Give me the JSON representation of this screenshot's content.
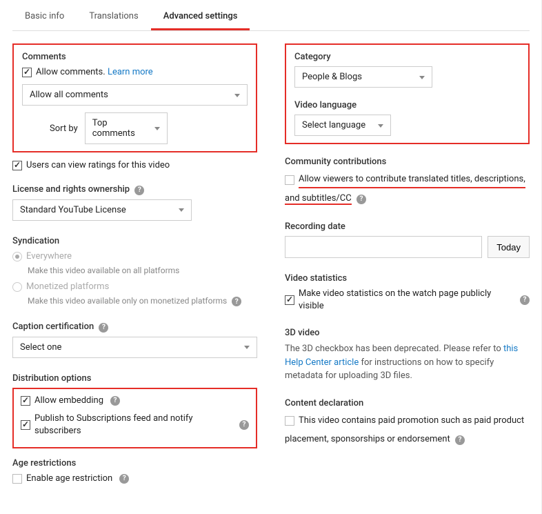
{
  "tabs": {
    "basic": "Basic info",
    "translations": "Translations",
    "advanced": "Advanced settings"
  },
  "left": {
    "comments": {
      "title": "Comments",
      "allow": "Allow comments.",
      "learn_more": "Learn more",
      "moderation": "Allow all comments",
      "sort_label": "Sort by",
      "sort_value": "Top comments"
    },
    "ratings": "Users can view ratings for this video",
    "license": {
      "title": "License and rights ownership",
      "value": "Standard YouTube License"
    },
    "syndication": {
      "title": "Syndication",
      "everywhere": "Everywhere",
      "everywhere_desc": "Make this video available on all platforms",
      "monetized": "Monetized platforms",
      "monetized_desc": "Make this video available only on monetized platforms"
    },
    "caption": {
      "title": "Caption certification",
      "value": "Select one"
    },
    "distribution": {
      "title": "Distribution options",
      "embedding": "Allow embedding",
      "publish": "Publish to Subscriptions feed and notify subscribers"
    },
    "age": {
      "title": "Age restrictions",
      "enable": "Enable age restriction"
    }
  },
  "right": {
    "category": {
      "title": "Category",
      "value": "People & Blogs"
    },
    "language": {
      "title": "Video language",
      "value": "Select language"
    },
    "community": {
      "title": "Community contributions",
      "text1": "Allow viewers to contribute translated titles, descriptions,",
      "text2": "and subtitles/CC"
    },
    "recording": {
      "title": "Recording date",
      "today": "Today"
    },
    "stats": {
      "title": "Video statistics",
      "text": "Make video statistics on the watch page publicly visible"
    },
    "video3d": {
      "title": "3D video",
      "pre": "The 3D checkbox has been deprecated. Please refer to ",
      "link": "this Help Center article",
      "post": " for instructions on how to specify metadata for uploading 3D files."
    },
    "declaration": {
      "title": "Content declaration",
      "text1": "This video contains paid promotion such as paid product",
      "text2": "placement, sponsorships or endorsement"
    }
  }
}
